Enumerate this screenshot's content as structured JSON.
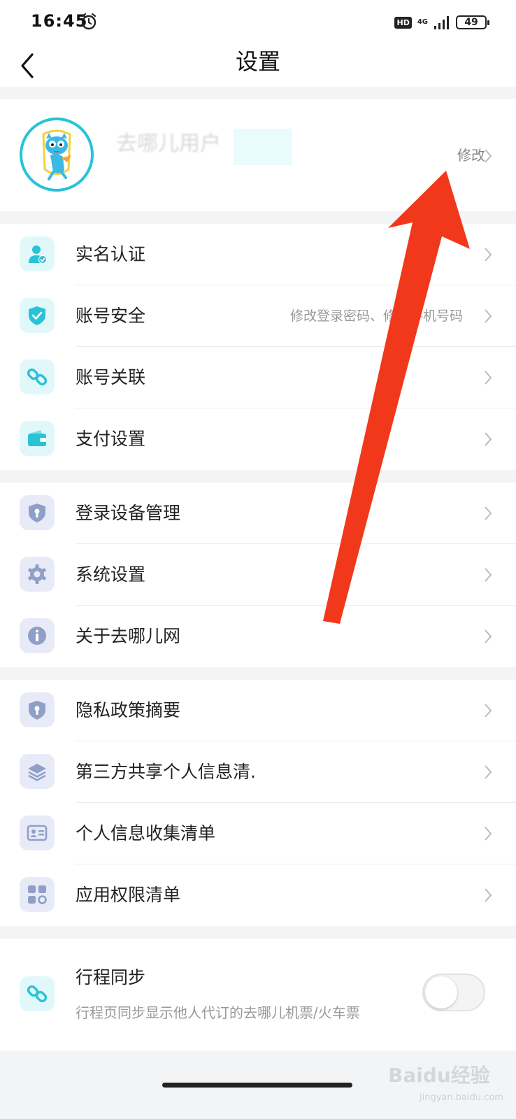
{
  "status_bar": {
    "time": "16:45",
    "hd": "HD",
    "network": "4G",
    "battery": "49"
  },
  "header": {
    "title": "设置"
  },
  "profile": {
    "name": "去哪儿用户",
    "edit_label": "修改"
  },
  "group1": [
    {
      "label": "实名认证",
      "sub": "",
      "icon": "id-check-icon"
    },
    {
      "label": "账号安全",
      "sub": "修改登录密码、修改手机号码",
      "icon": "shield-check-icon"
    },
    {
      "label": "账号关联",
      "sub": "",
      "icon": "link-icon"
    },
    {
      "label": "支付设置",
      "sub": "",
      "icon": "wallet-icon"
    }
  ],
  "group2": [
    {
      "label": "登录设备管理",
      "icon": "shield-key-icon"
    },
    {
      "label": "系统设置",
      "icon": "gear-icon"
    },
    {
      "label": "关于去哪儿网",
      "icon": "info-icon"
    }
  ],
  "group3": [
    {
      "label": "隐私政策摘要",
      "icon": "shield-key-icon"
    },
    {
      "label": "第三方共享个人信息清.",
      "icon": "layers-icon"
    },
    {
      "label": "个人信息收集清单",
      "icon": "id-card-icon"
    },
    {
      "label": "应用权限清单",
      "icon": "apps-grid-icon"
    }
  ],
  "sync": {
    "label": "行程同步",
    "desc": "行程页同步显示他人代订的去哪儿机票/火车票",
    "enabled": false
  },
  "watermark": {
    "brand": "Baidu经验",
    "site": "jingyan.baidu.com"
  },
  "colors": {
    "accent": "#27c3d8",
    "arrow": "#f2381b",
    "lavender": "#8fa0c8"
  }
}
